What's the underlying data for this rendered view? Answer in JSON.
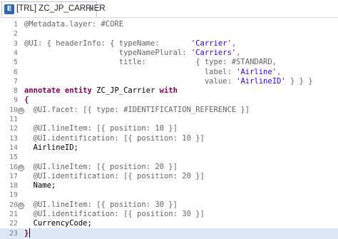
{
  "tab": {
    "file_icon": "abap-cds-file-icon",
    "title": "[TRL] ZC_JP_CARRIER",
    "close_glyph": "✕"
  },
  "colors": {
    "annotation": "#646464",
    "string": "#2a00ff",
    "keyword": "#7f0055",
    "line_number": "#7a7a7a",
    "current_line": "#dde7f6"
  },
  "editor": {
    "lines": [
      {
        "n": "1",
        "fold": "",
        "segs": [
          {
            "t": "@Metadata.layer: #CORE",
            "c": "ann"
          }
        ]
      },
      {
        "n": "2",
        "fold": "",
        "segs": []
      },
      {
        "n": "3",
        "fold": "",
        "segs": [
          {
            "t": "@UI: { headerInfo: { typeName:       ",
            "c": "ann"
          },
          {
            "t": "'Carrier'",
            "c": "str"
          },
          {
            "t": ",",
            "c": "ann"
          }
        ]
      },
      {
        "n": "4",
        "fold": "",
        "segs": [
          {
            "t": "                     typeNamePlural: ",
            "c": "ann"
          },
          {
            "t": "'Carriers'",
            "c": "str"
          },
          {
            "t": ",",
            "c": "ann"
          }
        ]
      },
      {
        "n": "5",
        "fold": "",
        "segs": [
          {
            "t": "                     title:           { type: #STANDARD,",
            "c": "ann"
          }
        ]
      },
      {
        "n": "6",
        "fold": "",
        "segs": [
          {
            "t": "                                        label: ",
            "c": "ann"
          },
          {
            "t": "'Airline'",
            "c": "str"
          },
          {
            "t": ",",
            "c": "ann"
          }
        ]
      },
      {
        "n": "7",
        "fold": "",
        "segs": [
          {
            "t": "                                        value: ",
            "c": "ann"
          },
          {
            "t": "'AirlineID'",
            "c": "str"
          },
          {
            "t": " } } }",
            "c": "ann"
          }
        ]
      },
      {
        "n": "8",
        "fold": "",
        "segs": [
          {
            "t": "annotate entity ",
            "c": "kw"
          },
          {
            "t": "ZC_JP_Carrier ",
            "c": "plain"
          },
          {
            "t": "with",
            "c": "kw"
          }
        ]
      },
      {
        "n": "9",
        "fold": "",
        "segs": [
          {
            "t": "{",
            "c": "kw"
          }
        ]
      },
      {
        "n": "10",
        "fold": "⊖",
        "segs": [
          {
            "t": "  @UI.facet: [{ type: #IDENTIFICATION_REFERENCE }]",
            "c": "ann"
          }
        ]
      },
      {
        "n": "11",
        "fold": "",
        "segs": []
      },
      {
        "n": "12",
        "fold": "",
        "segs": [
          {
            "t": "  @UI.lineItem: [{ position: 10 }]",
            "c": "ann"
          }
        ]
      },
      {
        "n": "13",
        "fold": "",
        "segs": [
          {
            "t": "  @UI.identification: [{ position: 10 }]",
            "c": "ann"
          }
        ]
      },
      {
        "n": "14",
        "fold": "",
        "segs": [
          {
            "t": "  AirlineID;",
            "c": "plain"
          }
        ]
      },
      {
        "n": "15",
        "fold": "",
        "segs": []
      },
      {
        "n": "16",
        "fold": "⊖",
        "segs": [
          {
            "t": "  @UI.lineItem: [{ position: 20 }]",
            "c": "ann"
          }
        ]
      },
      {
        "n": "17",
        "fold": "",
        "segs": [
          {
            "t": "  @UI.identification: [{ position: 20 }]",
            "c": "ann"
          }
        ]
      },
      {
        "n": "18",
        "fold": "",
        "segs": [
          {
            "t": "  Name;",
            "c": "plain"
          }
        ]
      },
      {
        "n": "19",
        "fold": "",
        "segs": []
      },
      {
        "n": "20",
        "fold": "⊖",
        "segs": [
          {
            "t": "  @UI.lineItem: [{ position: 30 }]",
            "c": "ann"
          }
        ]
      },
      {
        "n": "21",
        "fold": "",
        "segs": [
          {
            "t": "  @UI.identification: [{ position: 30 }]",
            "c": "ann"
          }
        ]
      },
      {
        "n": "22",
        "fold": "",
        "segs": [
          {
            "t": "  CurrencyCode;",
            "c": "plain"
          }
        ]
      },
      {
        "n": "23",
        "fold": "",
        "segs": [
          {
            "t": "}",
            "c": "kw"
          }
        ],
        "current": true
      }
    ]
  }
}
